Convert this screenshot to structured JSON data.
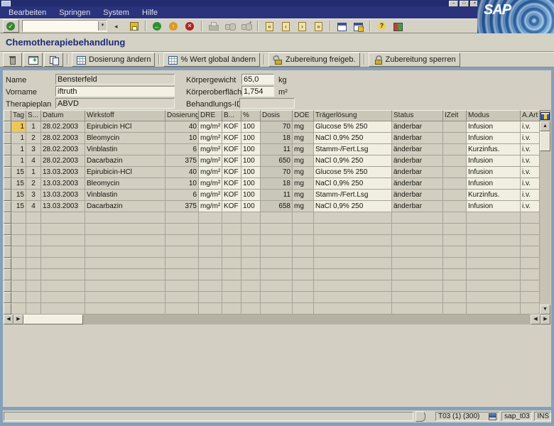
{
  "branding": {
    "logo_text": "SAP"
  },
  "menubar": {
    "items": [
      "Bearbeiten",
      "Springen",
      "System",
      "Hilfe"
    ]
  },
  "toolbar": {
    "command_value": "",
    "groups": [
      [
        "collapse-arrow",
        "save"
      ],
      [
        "back",
        "exit",
        "cancel"
      ],
      [
        "print",
        "find",
        "find-next"
      ],
      [
        "first-page",
        "previous-page",
        "next-page",
        "last-page"
      ],
      [
        "new-session",
        "create-shortcut"
      ],
      [
        "help",
        "customize-layout"
      ]
    ]
  },
  "screen": {
    "title": "Chemotherapiebehandlung"
  },
  "app_toolbar": {
    "buttons": [
      {
        "name": "delete-row-button",
        "icon": "delete-row",
        "label": ""
      },
      {
        "name": "insert-row-button",
        "icon": "insert-row",
        "label": ""
      },
      {
        "name": "copy-row-button",
        "icon": "copy-row",
        "label": ""
      },
      {
        "name": "dosierung-aendern-button",
        "icon": "grid",
        "label": "Dosierung ändern"
      },
      {
        "name": "prozent-wert-global-aendern-button",
        "icon": "grid",
        "label": "% Wert global ändern"
      },
      {
        "name": "zubereitung-freigeben-button",
        "icon": "unlock",
        "label": "Zubereitung freigeb."
      },
      {
        "name": "zubereitung-sperren-button",
        "icon": "lock",
        "label": "Zubereitung sperren"
      }
    ]
  },
  "form": {
    "name_label": "Name",
    "name_value": "Bensterfeld",
    "vorname_label": "Vorname",
    "vorname_value": "iftruth",
    "therapieplan_label": "Therapieplan",
    "therapieplan_value": "ABVD",
    "koerpergewicht_label": "Körpergewicht",
    "koerpergewicht_value": "65,0",
    "koerpergewicht_unit": "kg",
    "koerperoberflaeche_label": "Körperoberfläche",
    "koerperoberflaeche_value": "1,754",
    "koerperoberflaeche_unit": "m²",
    "behandlungs_id_label": "Behandlungs-ID",
    "behandlungs_id_value": ""
  },
  "table": {
    "columns": [
      {
        "key": "tag",
        "label": "Tag"
      },
      {
        "key": "s",
        "label": "S..."
      },
      {
        "key": "datum",
        "label": "Datum"
      },
      {
        "key": "wirkstoff",
        "label": "Wirkstoff"
      },
      {
        "key": "dosierung",
        "label": "Dosierung"
      },
      {
        "key": "dre",
        "label": "DRE"
      },
      {
        "key": "b",
        "label": "B..."
      },
      {
        "key": "pct",
        "label": "%"
      },
      {
        "key": "dosis",
        "label": "Dosis"
      },
      {
        "key": "doe",
        "label": "DOE"
      },
      {
        "key": "traeger",
        "label": "Trägerlösung"
      },
      {
        "key": "status",
        "label": "Status"
      },
      {
        "key": "izeit",
        "label": "IZeit"
      },
      {
        "key": "modus",
        "label": "Modus"
      },
      {
        "key": "aart",
        "label": "A.Art"
      }
    ],
    "rows": [
      {
        "tag": "1",
        "s": "1",
        "datum": "28.02.2003",
        "wirkstoff": "Epirubicin HCl",
        "dosierung": "40",
        "dre": "mg/m²",
        "b": "KOF",
        "pct": "100",
        "dosis": "70",
        "doe": "mg",
        "traeger": "Glucose 5% 250",
        "status": "änderbar",
        "izeit": "",
        "modus": "Infusion",
        "aart": "i.v."
      },
      {
        "tag": "1",
        "s": "2",
        "datum": "28.02.2003",
        "wirkstoff": "Bleomycin",
        "dosierung": "10",
        "dre": "mg/m²",
        "b": "KOF",
        "pct": "100",
        "dosis": "18",
        "doe": "mg",
        "traeger": "NaCl 0,9% 250",
        "status": "änderbar",
        "izeit": "",
        "modus": "Infusion",
        "aart": "i.v."
      },
      {
        "tag": "1",
        "s": "3",
        "datum": "28.02.2003",
        "wirkstoff": "Vinblastin",
        "dosierung": "6",
        "dre": "mg/m²",
        "b": "KOF",
        "pct": "100",
        "dosis": "11",
        "doe": "mg",
        "traeger": "Stamm-/Fert.Lsg",
        "status": "änderbar",
        "izeit": "",
        "modus": "Kurzinfus.",
        "aart": "i.v."
      },
      {
        "tag": "1",
        "s": "4",
        "datum": "28.02.2003",
        "wirkstoff": "Dacarbazin",
        "dosierung": "375",
        "dre": "mg/m²",
        "b": "KOF",
        "pct": "100",
        "dosis": "650",
        "doe": "mg",
        "traeger": "NaCl 0,9% 250",
        "status": "änderbar",
        "izeit": "",
        "modus": "Infusion",
        "aart": "i.v."
      },
      {
        "tag": "15",
        "s": "1",
        "datum": "13.03.2003",
        "wirkstoff": "Epirubicin-HCl",
        "dosierung": "40",
        "dre": "mg/m²",
        "b": "KOF",
        "pct": "100",
        "dosis": "70",
        "doe": "mg",
        "traeger": "Glucose 5% 250",
        "status": "änderbar",
        "izeit": "",
        "modus": "Infusion",
        "aart": "i.v."
      },
      {
        "tag": "15",
        "s": "2",
        "datum": "13.03.2003",
        "wirkstoff": "Bleomycin",
        "dosierung": "10",
        "dre": "mg/m²",
        "b": "KOF",
        "pct": "100",
        "dosis": "18",
        "doe": "mg",
        "traeger": "NaCl 0,9% 250",
        "status": "änderbar",
        "izeit": "",
        "modus": "Infusion",
        "aart": "i.v."
      },
      {
        "tag": "15",
        "s": "3",
        "datum": "13.03.2003",
        "wirkstoff": "Vinblastin",
        "dosierung": "6",
        "dre": "mg/m²",
        "b": "KOF",
        "pct": "100",
        "dosis": "11",
        "doe": "mg",
        "traeger": "Stamm-/Fert.Lsg",
        "status": "änderbar",
        "izeit": "",
        "modus": "Kurzinfus.",
        "aart": "i.v."
      },
      {
        "tag": "15",
        "s": "4",
        "datum": "13.03.2003",
        "wirkstoff": "Dacarbazin",
        "dosierung": "375",
        "dre": "mg/m²",
        "b": "KOF",
        "pct": "100",
        "dosis": "658",
        "doe": "mg",
        "traeger": "NaCl 0,9% 250",
        "status": "änderbar",
        "izeit": "",
        "modus": "Infusion",
        "aart": "i.v."
      }
    ]
  },
  "statusbar": {
    "message": "",
    "system_box": "T03 (1) (300)",
    "server_box": "sap_t03",
    "mode_box": "INS"
  },
  "colors": {
    "menubar_navy": "#2a337b",
    "panel_gray": "#d4d1c5",
    "frame_blue": "#85a0bb",
    "cell_beige": "#d2cfc1",
    "cell_white": "#f1efe1",
    "cursor_yellow": "#edc75a",
    "title_navy": "#1c2a7a"
  }
}
